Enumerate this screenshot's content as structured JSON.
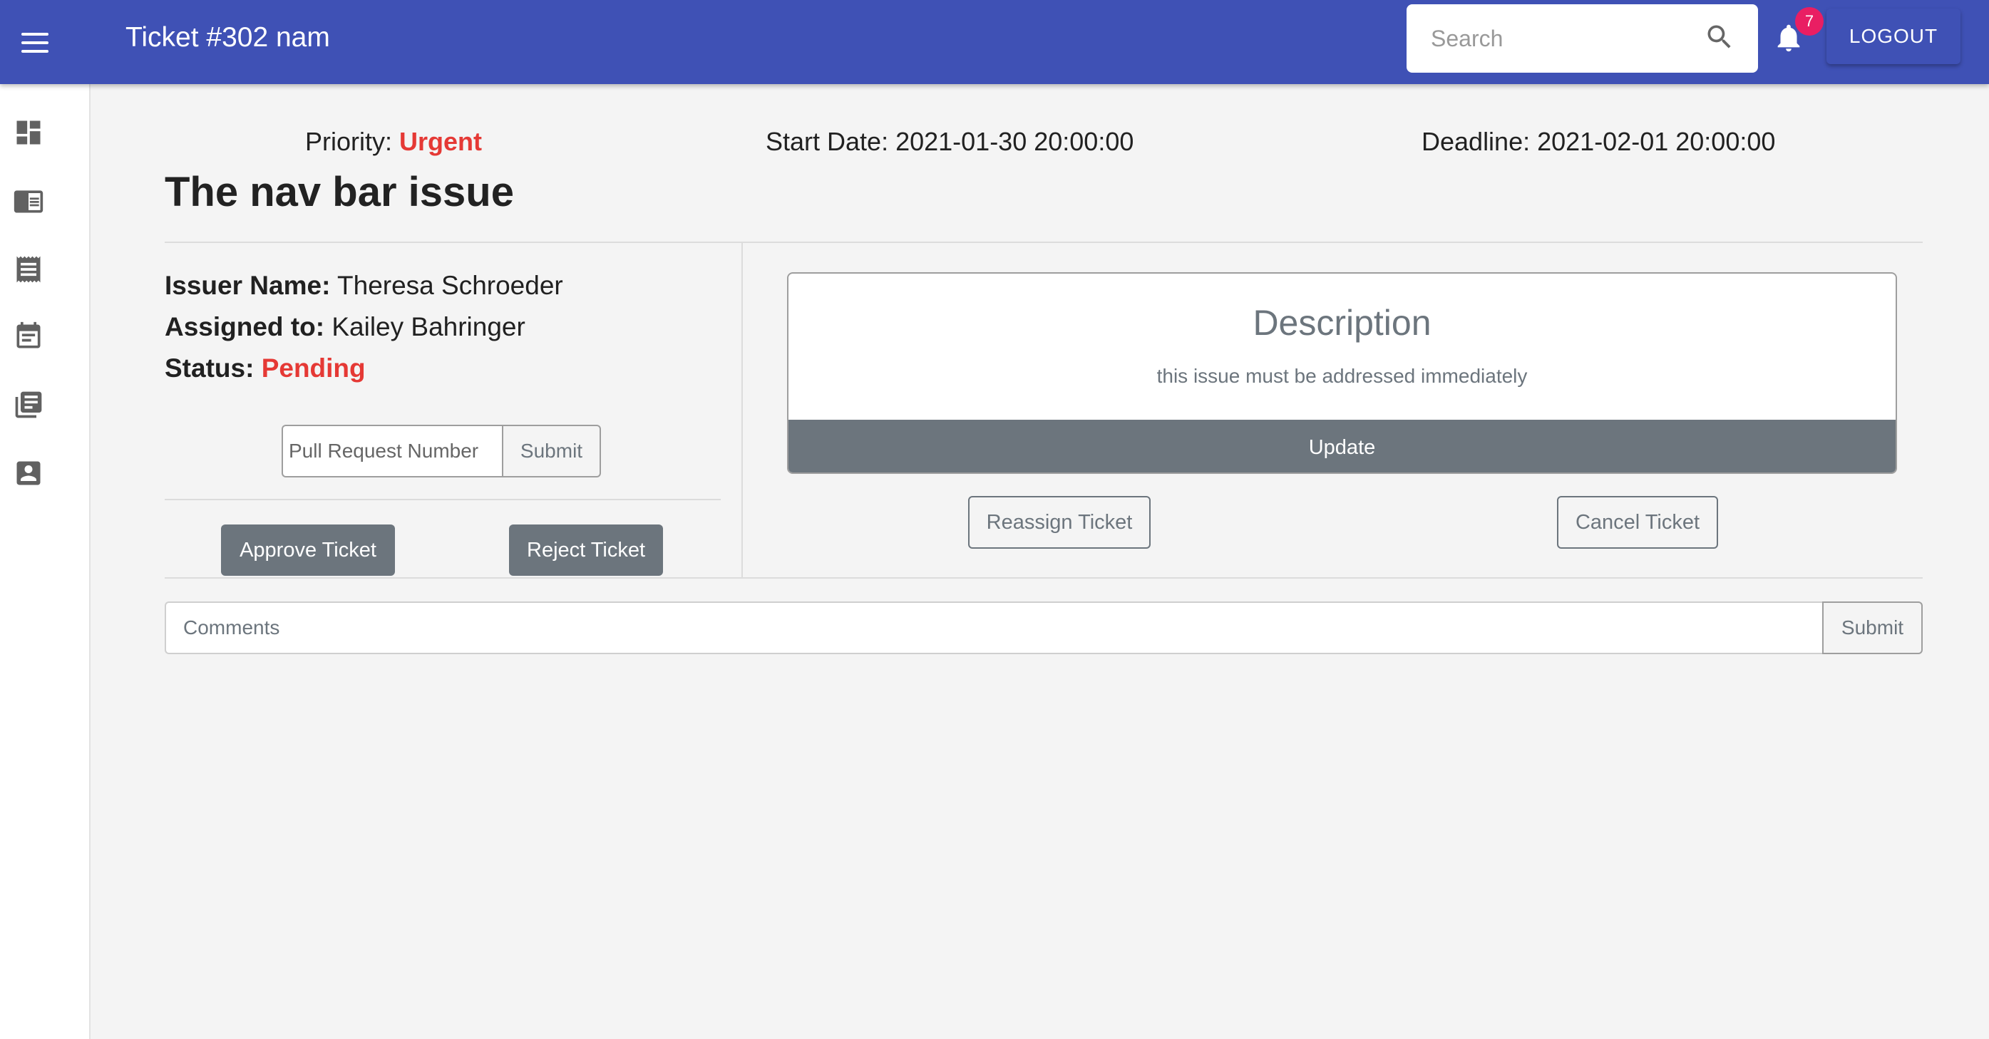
{
  "appbar": {
    "title": "Ticket #302 nam",
    "search_placeholder": "Search",
    "notification_count": "7",
    "logout_label": "LOGOUT",
    "color": "#3f51b5"
  },
  "sidebar": {
    "items": [
      {
        "icon": "dashboard-icon"
      },
      {
        "icon": "chrome-reader-icon"
      },
      {
        "icon": "receipt-icon"
      },
      {
        "icon": "event-note-icon"
      },
      {
        "icon": "library-books-icon"
      },
      {
        "icon": "account-box-icon"
      }
    ]
  },
  "ticket": {
    "priority_label": "Priority:",
    "priority_value": "Urgent",
    "start_date": "Start Date: 2021-01-30 20:00:00",
    "deadline": "Deadline: 2021-02-01 20:00:00",
    "title": "The nav bar issue",
    "issuer_label": "Issuer Name:",
    "issuer_value": "Theresa Schroeder",
    "assigned_label": "Assigned to:",
    "assigned_value": "Kailey Bahringer",
    "status_label": "Status:",
    "status_value": "Pending",
    "status_color": "#e53935"
  },
  "pull_request": {
    "placeholder": "Pull Request Number",
    "submit_label": "Submit"
  },
  "actions": {
    "approve_label": "Approve Ticket",
    "reject_label": "Reject Ticket",
    "reassign_label": "Reassign Ticket",
    "cancel_label": "Cancel Ticket"
  },
  "description": {
    "title": "Description",
    "text": "this issue must be addressed immediately",
    "update_label": "Update"
  },
  "comments": {
    "placeholder": "Comments",
    "submit_label": "Submit"
  }
}
